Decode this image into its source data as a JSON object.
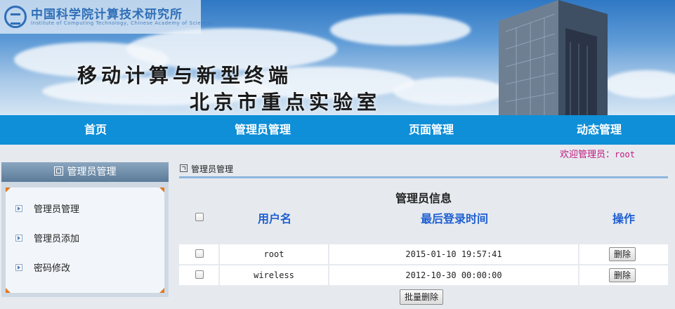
{
  "banner": {
    "logo_text_cn": "中国科学院计算技术研究所",
    "logo_text_en": "Institute of Computing Technology, Chinese Academy of Sciences",
    "slogan_line1": "移动计算与新型终端",
    "slogan_line2": "北京市重点实验室"
  },
  "nav": {
    "items": [
      "首页",
      "管理员管理",
      "页面管理",
      "动态管理"
    ]
  },
  "welcome": {
    "label": "欢迎管理员：",
    "user": "root"
  },
  "sidebar": {
    "header": "管理员管理",
    "items": [
      "管理员管理",
      "管理员添加",
      "密码修改"
    ]
  },
  "main": {
    "breadcrumb": "管理员管理",
    "table_title": "管理员信息",
    "columns": [
      "用户名",
      "最后登录时间",
      "操作"
    ],
    "rows": [
      {
        "username": "root",
        "last_login": "2015-01-10 19:57:41",
        "action": "删除"
      },
      {
        "username": "wireless",
        "last_login": "2012-10-30 00:00:00",
        "action": "删除"
      }
    ],
    "batch_delete": "批量删除"
  },
  "colors": {
    "nav_bg": "#0f8fd8",
    "header_text": "#1f5fd1",
    "welcome": "#c2187d"
  }
}
